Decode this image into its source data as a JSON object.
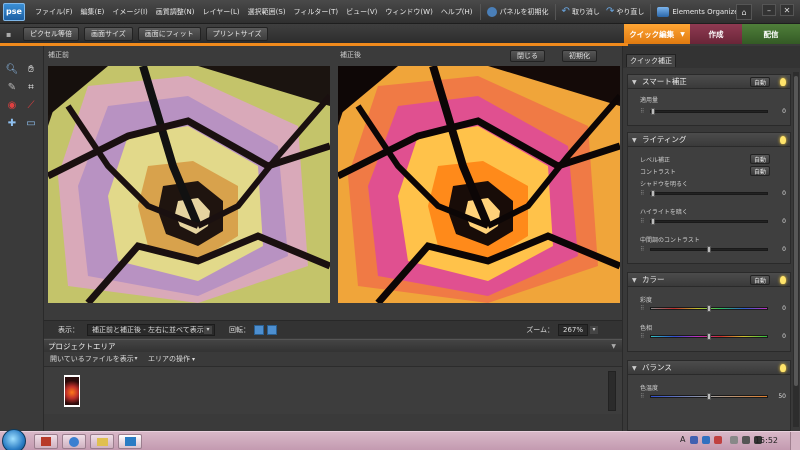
{
  "app": {
    "logo": "pse"
  },
  "menu": [
    "ファイル(F)",
    "編集(E)",
    "イメージ(I)",
    "画質調整(N)",
    "レイヤー(L)",
    "選択範囲(S)",
    "フィルター(T)",
    "ビュー(V)",
    "ウィンドウ(W)",
    "ヘルプ(H)"
  ],
  "menubar_buttons": {
    "reset_panels": "パネルを初期化",
    "undo": "取り消し",
    "redo": "やり直し",
    "organizer": "Elements Organizer"
  },
  "options_bar": {
    "actual_pixels": "ピクセル等倍",
    "fit_screen": "画面サイズ",
    "fill_screen": "画面にフィット",
    "print_size": "プリントサイズ"
  },
  "mode_tabs": {
    "quick_fix": "クイック編集",
    "create": "作成",
    "share": "配信"
  },
  "canvas": {
    "before_label": "補正前",
    "after_label": "補正後",
    "close_btn": "閉じる",
    "reset_btn": "初期化"
  },
  "viewbar": {
    "view_label": "表示：",
    "view_value": "補正前と補正後 - 左右に並べて表示",
    "rotate_label": "回転：",
    "zoom_label": "ズーム：",
    "zoom_value": "267%"
  },
  "project": {
    "title": "プロジェクトエリア",
    "show_files": "開いているファイルを表示",
    "area_actions": "エリアの操作"
  },
  "right_panel": {
    "tab": "クイック補正",
    "smart_fix": {
      "title": "スマート補正",
      "auto": "自動",
      "amount_label": "適用量",
      "amount_value": "0",
      "amount_level": 0.0
    },
    "lighting": {
      "title": "ライティング",
      "levels_label": "レベル補正",
      "levels_auto": "自動",
      "contrast_label": "コントラスト",
      "contrast_auto": "自動",
      "shadows_label": "シャドウを明るく",
      "shadows_value": "0",
      "shadows_level": 0.0,
      "highlights_label": "ハイライトを暗く",
      "highlights_value": "0",
      "highlights_level": 0.0,
      "midtone_label": "中間調のコントラスト",
      "midtone_value": "0",
      "midtone_level": 0.5
    },
    "color": {
      "title": "カラー",
      "auto": "自動",
      "saturation_label": "彩度",
      "saturation_value": "0",
      "saturation_level": 0.5,
      "hue_label": "色相",
      "hue_value": "0",
      "hue_level": 0.5
    },
    "balance": {
      "title": "バランス",
      "temp_label": "色温度",
      "temp_value": "50",
      "temp_level": 0.5
    }
  },
  "taskbar": {
    "clock": "15:52"
  },
  "colors": {
    "accent": "#f08a1c",
    "mode_create": "#7a2f43",
    "mode_share": "#3f6b2f"
  }
}
